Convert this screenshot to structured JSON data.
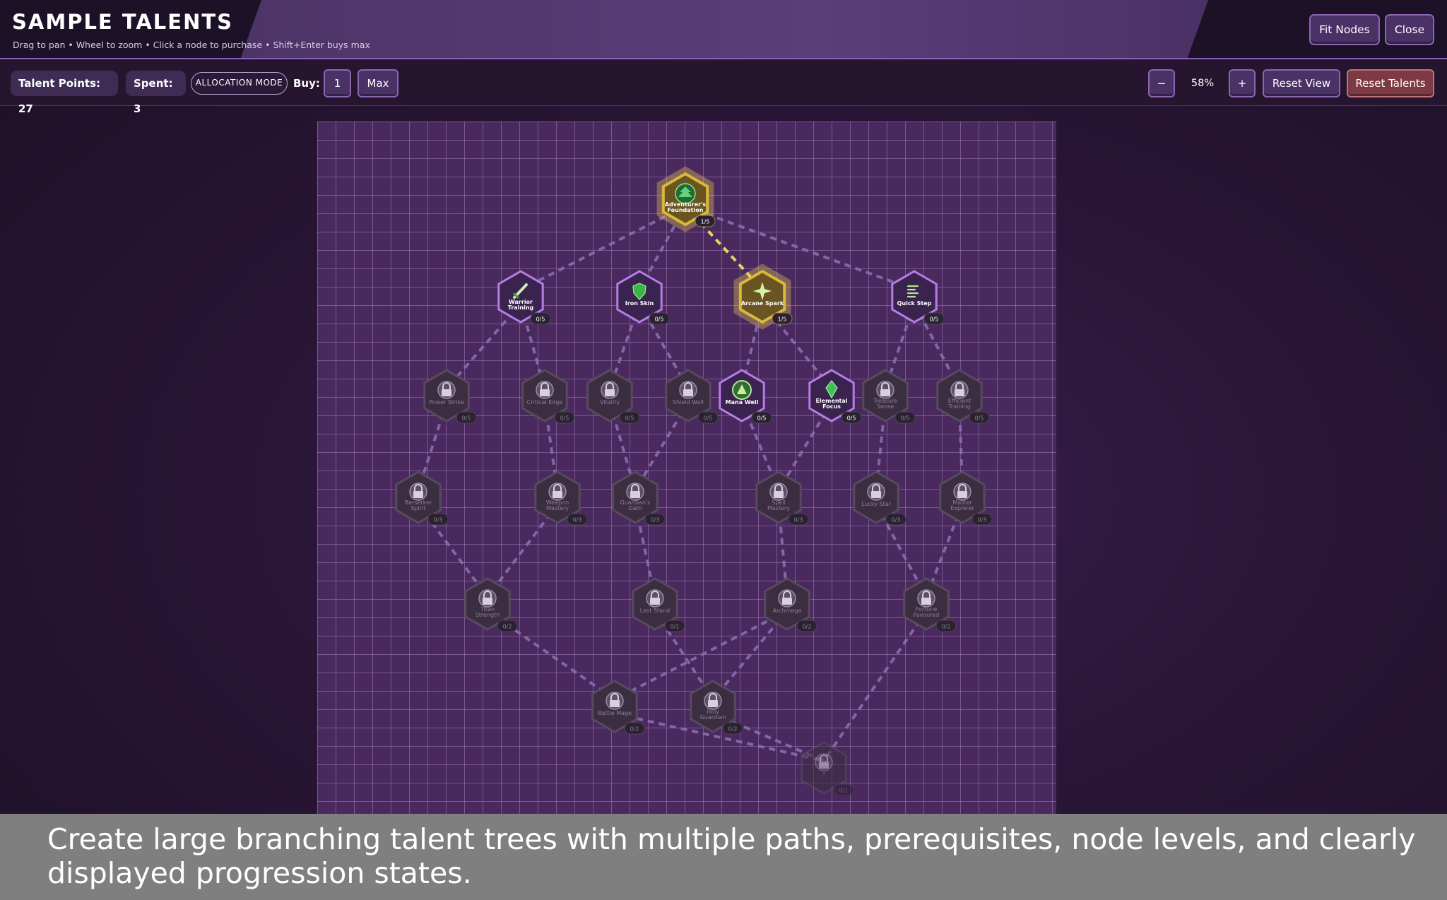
{
  "header": {
    "title": "SAMPLE TALENTS",
    "subtitle": "Drag to pan • Wheel to zoom • Click a node to purchase • Shift+Enter buys max",
    "fit_nodes_label": "Fit Nodes",
    "close_label": "Close"
  },
  "toolbar": {
    "talent_points": "Talent Points: 27",
    "spent": "Spent: 3",
    "allocation_mode": "ALLOCATION MODE",
    "buy_label": "Buy:",
    "buy_one": "1",
    "buy_max": "Max",
    "zoom_out": "−",
    "zoom_level": "58%",
    "zoom_in": "+",
    "reset_view": "Reset View",
    "reset_talents": "Reset Talents"
  },
  "colors": {
    "owned": "#d8b93c",
    "available": "#b57ee6",
    "locked": "#4a3a55",
    "connection_active": "#e8d35c",
    "connection": "#8d6cae"
  },
  "tree": {
    "nodes": [
      {
        "id": "adventurers-foundation",
        "label": [
          "Adventurer's",
          "Foundation"
        ],
        "level": "1/5",
        "state": "owned",
        "icon": "tree-icon"
      },
      {
        "id": "warrior-training",
        "label": [
          "Warrior",
          "Training"
        ],
        "level": "0/5",
        "state": "available",
        "icon": "sword-icon"
      },
      {
        "id": "iron-skin",
        "label": [
          "Iron Skin"
        ],
        "level": "0/5",
        "state": "available",
        "icon": "shield-icon"
      },
      {
        "id": "arcane-spark",
        "label": [
          "Arcane Spark"
        ],
        "level": "1/5",
        "state": "owned",
        "icon": "spark-icon"
      },
      {
        "id": "quick-step",
        "label": [
          "Quick Step"
        ],
        "level": "0/5",
        "state": "available",
        "icon": "wind-icon"
      },
      {
        "id": "power-strike",
        "label": [
          "Power Strike"
        ],
        "level": "0/5",
        "state": "locked",
        "icon": "lock-icon"
      },
      {
        "id": "critical-edge",
        "label": [
          "Critical Edge"
        ],
        "level": "0/5",
        "state": "locked",
        "icon": "lock-icon"
      },
      {
        "id": "vitality",
        "label": [
          "Vitality"
        ],
        "level": "0/5",
        "state": "locked",
        "icon": "lock-icon"
      },
      {
        "id": "shield-wall",
        "label": [
          "Shield Wall"
        ],
        "level": "0/5",
        "state": "locked",
        "icon": "lock-icon"
      },
      {
        "id": "mana-well",
        "label": [
          "Mana Well"
        ],
        "level": "0/5",
        "state": "available",
        "icon": "mana-icon"
      },
      {
        "id": "elemental-focus",
        "label": [
          "Elemental",
          "Focus"
        ],
        "level": "0/5",
        "state": "available",
        "icon": "crystal-icon"
      },
      {
        "id": "treasure-sense",
        "label": [
          "Treasure",
          "Sense"
        ],
        "level": "0/5",
        "state": "locked",
        "icon": "lock-icon"
      },
      {
        "id": "efficient-training",
        "label": [
          "Efficient",
          "Training"
        ],
        "level": "0/5",
        "state": "locked",
        "icon": "lock-icon"
      },
      {
        "id": "berserker-spirit",
        "label": [
          "Berserker",
          "Spirit"
        ],
        "level": "0/3",
        "state": "locked",
        "icon": "lock-icon"
      },
      {
        "id": "weapon-mastery",
        "label": [
          "Weapon",
          "Mastery"
        ],
        "level": "0/3",
        "state": "locked",
        "icon": "lock-icon"
      },
      {
        "id": "guardians-oath",
        "label": [
          "Guardian's",
          "Oath"
        ],
        "level": "0/3",
        "state": "locked",
        "icon": "lock-icon"
      },
      {
        "id": "spell-mastery",
        "label": [
          "Spell",
          "Mastery"
        ],
        "level": "0/3",
        "state": "locked",
        "icon": "lock-icon"
      },
      {
        "id": "lucky-star",
        "label": [
          "Lucky Star"
        ],
        "level": "0/3",
        "state": "locked",
        "icon": "lock-icon"
      },
      {
        "id": "master-explorer",
        "label": [
          "Master",
          "Explorer"
        ],
        "level": "0/3",
        "state": "locked",
        "icon": "lock-icon"
      },
      {
        "id": "titan-strength",
        "label": [
          "Titan",
          "Strength"
        ],
        "level": "0/2",
        "state": "locked",
        "icon": "lock-icon"
      },
      {
        "id": "last-stand",
        "label": [
          "Last Stand"
        ],
        "level": "0/1",
        "state": "locked",
        "icon": "lock-icon"
      },
      {
        "id": "archmage",
        "label": [
          "Archmage"
        ],
        "level": "0/2",
        "state": "locked",
        "icon": "lock-icon"
      },
      {
        "id": "fortune-favoured",
        "label": [
          "Fortune",
          "Favoured"
        ],
        "level": "0/2",
        "state": "locked",
        "icon": "lock-icon"
      },
      {
        "id": "battle-mage",
        "label": [
          "Battle Mage"
        ],
        "level": "0/2",
        "state": "locked",
        "icon": "lock-icon"
      },
      {
        "id": "holy-guardian",
        "label": [
          "Holy",
          "Guardian"
        ],
        "level": "0/2",
        "state": "locked",
        "icon": "lock-icon"
      },
      {
        "id": "hidden-capstone",
        "label": [
          "?"
        ],
        "level": "0/1",
        "state": "hidden",
        "icon": "lock-icon"
      }
    ],
    "edges": [
      [
        "adventurers-foundation",
        "warrior-training",
        "inactive"
      ],
      [
        "adventurers-foundation",
        "iron-skin",
        "inactive"
      ],
      [
        "adventurers-foundation",
        "arcane-spark",
        "active"
      ],
      [
        "adventurers-foundation",
        "quick-step",
        "inactive"
      ],
      [
        "warrior-training",
        "power-strike",
        "inactive"
      ],
      [
        "warrior-training",
        "critical-edge",
        "inactive"
      ],
      [
        "iron-skin",
        "vitality",
        "inactive"
      ],
      [
        "iron-skin",
        "shield-wall",
        "inactive"
      ],
      [
        "arcane-spark",
        "mana-well",
        "inactive"
      ],
      [
        "arcane-spark",
        "elemental-focus",
        "inactive"
      ],
      [
        "quick-step",
        "treasure-sense",
        "inactive"
      ],
      [
        "quick-step",
        "efficient-training",
        "inactive"
      ],
      [
        "power-strike",
        "berserker-spirit",
        "inactive"
      ],
      [
        "critical-edge",
        "weapon-mastery",
        "inactive"
      ],
      [
        "vitality",
        "guardians-oath",
        "inactive"
      ],
      [
        "shield-wall",
        "guardians-oath",
        "inactive"
      ],
      [
        "mana-well",
        "spell-mastery",
        "inactive"
      ],
      [
        "elemental-focus",
        "spell-mastery",
        "inactive"
      ],
      [
        "treasure-sense",
        "lucky-star",
        "inactive"
      ],
      [
        "efficient-training",
        "master-explorer",
        "inactive"
      ],
      [
        "berserker-spirit",
        "titan-strength",
        "inactive"
      ],
      [
        "weapon-mastery",
        "titan-strength",
        "inactive"
      ],
      [
        "guardians-oath",
        "last-stand",
        "inactive"
      ],
      [
        "spell-mastery",
        "archmage",
        "inactive"
      ],
      [
        "lucky-star",
        "fortune-favoured",
        "inactive"
      ],
      [
        "master-explorer",
        "fortune-favoured",
        "inactive"
      ],
      [
        "titan-strength",
        "battle-mage",
        "inactive"
      ],
      [
        "archmage",
        "battle-mage",
        "inactive"
      ],
      [
        "last-stand",
        "holy-guardian",
        "inactive"
      ],
      [
        "archmage",
        "holy-guardian",
        "inactive"
      ],
      [
        "battle-mage",
        "hidden-capstone",
        "inactive"
      ],
      [
        "holy-guardian",
        "hidden-capstone",
        "inactive"
      ],
      [
        "fortune-favoured",
        "hidden-capstone",
        "inactive"
      ]
    ]
  },
  "caption": "Create large branching talent trees with multiple paths, prerequisites, node levels, and clearly displayed progression states."
}
